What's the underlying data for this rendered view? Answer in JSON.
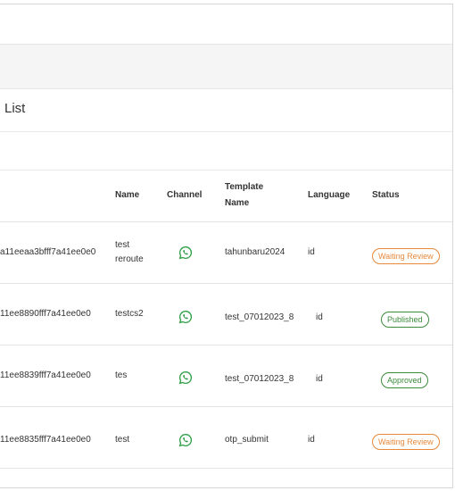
{
  "page": {
    "title": "List"
  },
  "table": {
    "columns": {
      "name": "Name",
      "channel": "Channel",
      "template_name_line1": "Template",
      "template_name_line2": "Name",
      "language": "Language",
      "status": "Status"
    },
    "rows": [
      {
        "id": "a11eeaa3bfff7a41ee0e0",
        "name_line1": "test",
        "name_line2": "reroute",
        "channel_icon": "whatsapp-icon",
        "template": "tahunbaru2024",
        "language": "id",
        "status": "Waiting Review",
        "status_color": "#e8893b"
      },
      {
        "id": "11ee8890fff7a41ee0e0",
        "name_line1": "testcs2",
        "name_line2": "",
        "channel_icon": "whatsapp-icon",
        "template": "test_07012023_8",
        "language": "id",
        "status": "Published",
        "status_color": "#3c8a3c"
      },
      {
        "id": "11ee8839fff7a41ee0e0",
        "name_line1": "tes",
        "name_line2": "",
        "channel_icon": "whatsapp-icon",
        "template": "test_07012023_8",
        "language": "id",
        "status": "Approved",
        "status_color": "#3c8a3c"
      },
      {
        "id": "11ee8835fff7a41ee0e0",
        "name_line1": "test",
        "name_line2": "",
        "channel_icon": "whatsapp-icon",
        "template": "otp_submit",
        "language": "id",
        "status": "Waiting Review",
        "status_color": "#e8893b"
      }
    ]
  },
  "colors": {
    "whatsapp": "#2e9e45",
    "waiting": "#e8893b",
    "approved": "#3c8a3c"
  }
}
